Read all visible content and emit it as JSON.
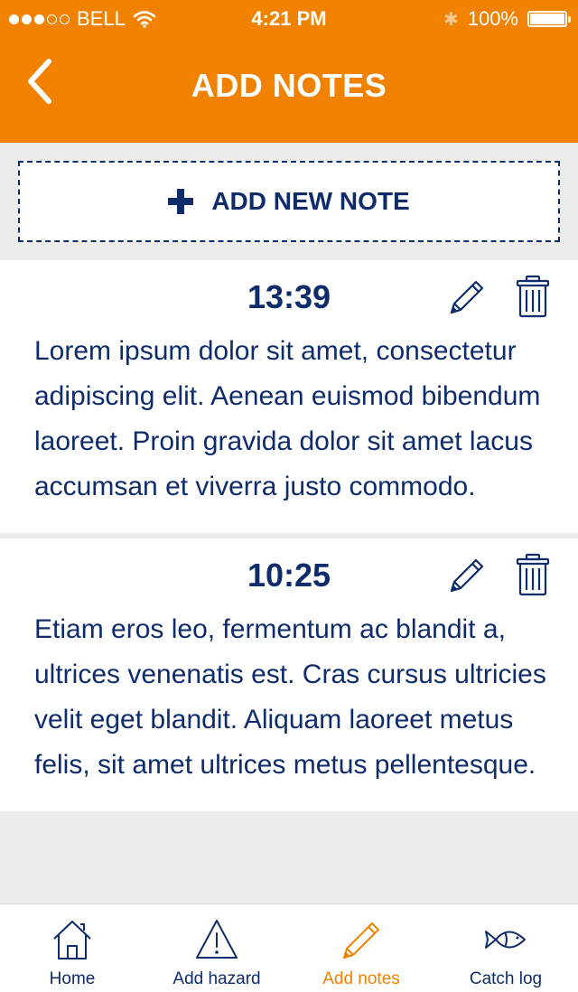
{
  "status_bar": {
    "carrier": "BELL",
    "time": "4:21 PM",
    "battery": "100%",
    "signal_bars_filled": 3,
    "signal_bars_total": 5,
    "battery_level": 1.0
  },
  "header": {
    "title": "ADD NOTES",
    "back_icon": "chevron-left-icon"
  },
  "add_note": {
    "label": "ADD NEW NOTE",
    "icon": "plus-icon"
  },
  "notes": [
    {
      "time": "13:39",
      "text": "Lorem ipsum dolor sit amet, consectetur adipiscing elit. Aenean euismod bibendum laoreet. Proin gravida dolor sit amet lacus accumsan et viverra justo commodo."
    },
    {
      "time": "10:25",
      "text": "Etiam eros leo, fermentum ac blandit a, ultrices venenatis est. Cras cursus ultricies velit eget blandit. Aliquam laoreet metus felis, sit amet ultrices metus pellentesque."
    }
  ],
  "tabbar": {
    "items": [
      {
        "label": "Home",
        "icon": "home-icon",
        "active": false
      },
      {
        "label": "Add hazard",
        "icon": "warning-icon",
        "active": false
      },
      {
        "label": "Add notes",
        "icon": "pencil-icon",
        "active": true
      },
      {
        "label": "Catch log",
        "icon": "fish-icon",
        "active": false
      }
    ]
  },
  "colors": {
    "brand_orange": "#f08200",
    "navy": "#0e2c6b",
    "background": "#ebebe9"
  }
}
